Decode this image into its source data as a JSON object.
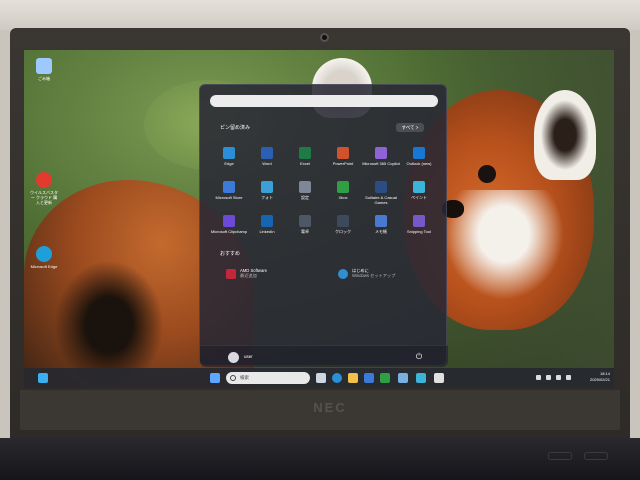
{
  "desktop": {
    "icons": [
      {
        "label": "ごみ箱",
        "icon": "recycle-bin-icon",
        "color": "#9ec9ff"
      },
      {
        "label": "ウイルスバスター クラウド 購入と更新",
        "icon": "virus-buster-icon",
        "color": "#e23b2e"
      },
      {
        "label": "Microsoft Edge",
        "icon": "edge-icon",
        "color": "#1f9fd9"
      }
    ]
  },
  "start_menu": {
    "search_placeholder": "",
    "pinned_title": "ピン留め済み",
    "all_apps_label": "すべて >",
    "pinned_apps": [
      {
        "label": "Edge",
        "color": "#2a8fd6"
      },
      {
        "label": "Word",
        "color": "#2b5fb4"
      },
      {
        "label": "Excel",
        "color": "#1e7b45"
      },
      {
        "label": "PowerPoint",
        "color": "#d2522e"
      },
      {
        "label": "Microsoft 365 Copilot",
        "color": "#8e63d6"
      },
      {
        "label": "Outlook (new)",
        "color": "#1877d2"
      },
      {
        "label": "Microsoft Store",
        "color": "#3b7ad9"
      },
      {
        "label": "フォト",
        "color": "#3aa0d8"
      },
      {
        "label": "設定",
        "color": "#7d8797"
      },
      {
        "label": "Xbox",
        "color": "#2f9e44"
      },
      {
        "label": "Solitaire & Casual Games",
        "color": "#2c4c84"
      },
      {
        "label": "ペイント",
        "color": "#3cb3d8"
      },
      {
        "label": "Microsoft Clipchamp",
        "color": "#6a4ad6"
      },
      {
        "label": "LinkedIn",
        "color": "#1565b0"
      },
      {
        "label": "電卓",
        "color": "#4d5766"
      },
      {
        "label": "クロック",
        "color": "#3d4a5c"
      },
      {
        "label": "メモ帳",
        "color": "#4a7ad0"
      },
      {
        "label": "Snipping Tool",
        "color": "#7857c9"
      }
    ],
    "recommended_title": "おすすめ",
    "recommended": [
      {
        "title": "AMD Software",
        "subtitle": "最近追加",
        "color": "#c2283a"
      },
      {
        "title": "はじめに",
        "subtitle": "Windows セットアップ",
        "color": "#2f8fd0"
      }
    ],
    "user_name": "user",
    "power_glyph": "⏻"
  },
  "taskbar": {
    "search_placeholder": "検索",
    "time": "18:14",
    "date": "2025/02/21"
  },
  "device": {
    "brand": "NEC"
  }
}
